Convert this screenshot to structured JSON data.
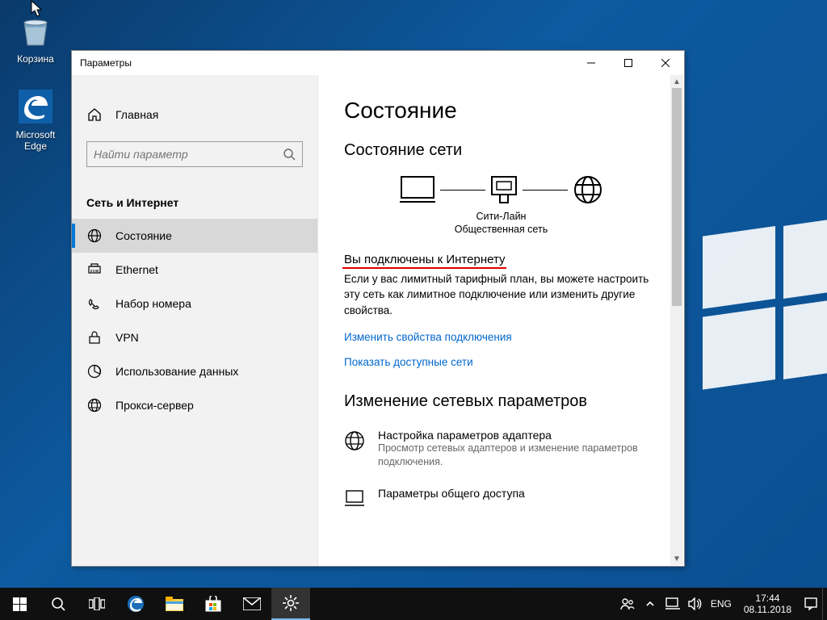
{
  "desktop": {
    "icons": [
      {
        "name": "recycle-bin",
        "label": "Корзина"
      },
      {
        "name": "edge",
        "label": "Microsoft Edge"
      }
    ]
  },
  "window": {
    "title": "Параметры",
    "home_label": "Главная",
    "search_placeholder": "Найти параметр",
    "section": "Сеть и Интернет",
    "nav": [
      {
        "label": "Состояние",
        "active": true,
        "icon": "status"
      },
      {
        "label": "Ethernet",
        "active": false,
        "icon": "ethernet"
      },
      {
        "label": "Набор номера",
        "active": false,
        "icon": "dialup"
      },
      {
        "label": "VPN",
        "active": false,
        "icon": "vpn"
      },
      {
        "label": "Использование данных",
        "active": false,
        "icon": "data"
      },
      {
        "label": "Прокси-сервер",
        "active": false,
        "icon": "proxy"
      }
    ],
    "content": {
      "h1": "Состояние",
      "h2_status": "Состояние сети",
      "net_name": "Сити-Лайн",
      "net_type": "Общественная сеть",
      "connected": "Вы подключены к Интернету",
      "connected_desc": "Если у вас лимитный тарифный план, вы можете настроить эту сеть как лимитное подключение или изменить другие свойства.",
      "link_props": "Изменить свойства подключения",
      "link_nets": "Показать доступные сети",
      "h2_change": "Изменение сетевых параметров",
      "adapter_t": "Настройка параметров адаптера",
      "adapter_d": "Просмотр сетевых адаптеров и изменение параметров подключения.",
      "sharing_t": "Параметры общего доступа"
    }
  },
  "taskbar": {
    "lang": "ENG",
    "time": "17:44",
    "date": "08.11.2018"
  }
}
